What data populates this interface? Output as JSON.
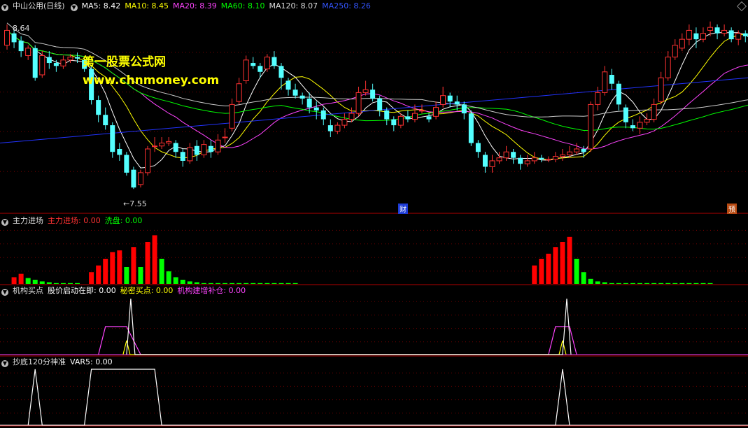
{
  "main": {
    "title": "中山公用(日线)",
    "ma": [
      {
        "label": "MA5: 8.42",
        "color": "#ffffff"
      },
      {
        "label": "MA10: 8.45",
        "color": "#ffff00"
      },
      {
        "label": "MA20: 8.39",
        "color": "#ff44ff"
      },
      {
        "label": "MA60: 8.10",
        "color": "#00ff00"
      },
      {
        "label": "MA120: 8.07",
        "color": "#dddddd"
      },
      {
        "label": "MA250: 8.26",
        "color": "#3333ff"
      }
    ],
    "high_label": "8.64",
    "low_label": "←7.55",
    "cai_tag": "财",
    "yu_tag": "预"
  },
  "watermark": {
    "line1": "第一股票公式网",
    "line2": "www.chnmoney.com"
  },
  "panel1": {
    "name": "主力进场",
    "s1": "主力进场: 0.00",
    "s2": "洗盘: 0.00"
  },
  "panel2": {
    "name": "机构买点",
    "s1": "股价启动在即: 0.00",
    "s2": "秘密买点: 0.00",
    "s3": "机构建增补仓: 0.00"
  },
  "panel3": {
    "name": "抄底120分神准",
    "s1": "VAR5: 0.00"
  },
  "colors": {
    "up": "#ff3232",
    "down": "#54ffff",
    "bar_red": "#ff0000",
    "bar_green": "#00ff00",
    "grid": "#7a0000",
    "divider": "#b00000"
  },
  "chart_data": {
    "type": "candlestick",
    "candles": [
      [
        8.52,
        8.62,
        8.66,
        8.49
      ],
      [
        8.6,
        8.54,
        8.62,
        8.5
      ],
      [
        8.55,
        8.48,
        8.58,
        8.44
      ],
      [
        8.45,
        8.5,
        8.52,
        8.42
      ],
      [
        8.5,
        8.3,
        8.52,
        8.28
      ],
      [
        8.32,
        8.45,
        8.48,
        8.3
      ],
      [
        8.44,
        8.4,
        8.48,
        8.36
      ],
      [
        8.4,
        8.38,
        8.42,
        8.34
      ],
      [
        8.38,
        8.42,
        8.45,
        8.36
      ],
      [
        8.42,
        8.44,
        8.46,
        8.4
      ],
      [
        8.44,
        8.43,
        8.47,
        8.4
      ],
      [
        8.42,
        8.36,
        8.44,
        8.34
      ],
      [
        8.36,
        8.15,
        8.38,
        8.12
      ],
      [
        8.15,
        8.05,
        8.18,
        8.0
      ],
      [
        8.05,
        7.98,
        8.1,
        7.95
      ],
      [
        7.98,
        7.8,
        8.0,
        7.76
      ],
      [
        7.82,
        7.78,
        7.86,
        7.74
      ],
      [
        7.78,
        7.66,
        7.8,
        7.64
      ],
      [
        7.68,
        7.56,
        7.7,
        7.55
      ],
      [
        7.58,
        7.66,
        7.68,
        7.56
      ],
      [
        7.66,
        7.82,
        7.84,
        7.64
      ],
      [
        7.84,
        7.84,
        7.9,
        7.8
      ],
      [
        7.84,
        7.86,
        7.9,
        7.82
      ],
      [
        7.86,
        7.87,
        7.9,
        7.84
      ],
      [
        7.86,
        7.8,
        7.88,
        7.76
      ],
      [
        7.8,
        7.74,
        7.82,
        7.7
      ],
      [
        7.74,
        7.83,
        7.86,
        7.72
      ],
      [
        7.84,
        7.78,
        7.88,
        7.74
      ],
      [
        7.78,
        7.85,
        7.88,
        7.76
      ],
      [
        7.84,
        7.8,
        7.88,
        7.76
      ],
      [
        7.8,
        7.88,
        7.92,
        7.78
      ],
      [
        7.9,
        7.9,
        7.96,
        7.86
      ],
      [
        7.96,
        8.12,
        8.16,
        7.94
      ],
      [
        8.14,
        8.26,
        8.3,
        8.12
      ],
      [
        8.28,
        8.42,
        8.45,
        8.26
      ],
      [
        8.4,
        8.38,
        8.44,
        8.36
      ],
      [
        8.38,
        8.34,
        8.4,
        8.3
      ],
      [
        8.36,
        8.44,
        8.46,
        8.34
      ],
      [
        8.44,
        8.38,
        8.48,
        8.36
      ],
      [
        8.38,
        8.3,
        8.4,
        8.22
      ],
      [
        8.28,
        8.22,
        8.3,
        8.18
      ],
      [
        8.22,
        8.18,
        8.26,
        8.16
      ],
      [
        8.18,
        8.16,
        8.2,
        8.12
      ],
      [
        8.16,
        8.1,
        8.2,
        8.06
      ],
      [
        8.1,
        8.08,
        8.14,
        8.02
      ],
      [
        8.08,
        8.02,
        8.1,
        7.98
      ],
      [
        7.98,
        7.94,
        8.02,
        7.9
      ],
      [
        7.94,
        7.98,
        8.0,
        7.92
      ],
      [
        7.98,
        8.02,
        8.06,
        7.96
      ],
      [
        8.02,
        8.06,
        8.1,
        8.0
      ],
      [
        8.06,
        8.2,
        8.24,
        8.04
      ],
      [
        8.2,
        8.22,
        8.28,
        8.18
      ],
      [
        8.22,
        8.16,
        8.26,
        8.14
      ],
      [
        8.16,
        8.08,
        8.18,
        8.04
      ],
      [
        8.08,
        8.02,
        8.1,
        7.98
      ],
      [
        8.02,
        7.98,
        8.04,
        7.94
      ],
      [
        7.98,
        8.04,
        8.06,
        7.96
      ],
      [
        8.04,
        8.02,
        8.08,
        8.0
      ],
      [
        8.02,
        8.06,
        8.12,
        8.0
      ],
      [
        8.08,
        8.08,
        8.12,
        8.06
      ],
      [
        8.04,
        8.02,
        8.06,
        8.0
      ],
      [
        8.04,
        8.1,
        8.14,
        8.02
      ],
      [
        8.12,
        8.18,
        8.24,
        8.1
      ],
      [
        8.18,
        8.14,
        8.2,
        8.1
      ],
      [
        8.14,
        8.12,
        8.18,
        8.08
      ],
      [
        8.12,
        8.06,
        8.14,
        8.02
      ],
      [
        8.06,
        7.86,
        8.08,
        7.84
      ],
      [
        7.86,
        7.8,
        7.88,
        7.76
      ],
      [
        7.78,
        7.7,
        7.8,
        7.66
      ],
      [
        7.7,
        7.74,
        7.78,
        7.66
      ],
      [
        7.74,
        7.76,
        7.8,
        7.72
      ],
      [
        7.76,
        7.8,
        7.84,
        7.74
      ],
      [
        7.8,
        7.76,
        7.82,
        7.72
      ],
      [
        7.76,
        7.72,
        7.78,
        7.68
      ],
      [
        7.72,
        7.74,
        7.78,
        7.7
      ],
      [
        7.74,
        7.76,
        7.8,
        7.72
      ],
      [
        7.76,
        7.75,
        7.78,
        7.73
      ],
      [
        7.75,
        7.75,
        7.77,
        7.73
      ],
      [
        7.75,
        7.77,
        7.8,
        7.73
      ],
      [
        7.77,
        7.78,
        7.82,
        7.74
      ],
      [
        7.78,
        7.8,
        7.84,
        7.76
      ],
      [
        7.8,
        7.82,
        7.86,
        7.78
      ],
      [
        7.82,
        7.8,
        7.84,
        7.76
      ],
      [
        7.82,
        8.12,
        8.14,
        7.8
      ],
      [
        8.12,
        8.2,
        8.24,
        8.08
      ],
      [
        8.2,
        8.34,
        8.38,
        8.18
      ],
      [
        8.32,
        8.26,
        8.36,
        8.22
      ],
      [
        8.26,
        8.12,
        8.28,
        8.08
      ],
      [
        8.1,
        8.0,
        8.12,
        7.96
      ],
      [
        7.98,
        7.96,
        8.02,
        7.94
      ],
      [
        7.96,
        8.0,
        8.04,
        7.92
      ],
      [
        8.0,
        8.02,
        8.06,
        7.98
      ],
      [
        8.02,
        8.12,
        8.16,
        8.0
      ],
      [
        8.14,
        8.3,
        8.34,
        8.12
      ],
      [
        8.3,
        8.44,
        8.48,
        8.28
      ],
      [
        8.44,
        8.52,
        8.56,
        8.42
      ],
      [
        8.5,
        8.56,
        8.6,
        8.48
      ],
      [
        8.56,
        8.62,
        8.66,
        8.52
      ],
      [
        8.6,
        8.56,
        8.64,
        8.5
      ],
      [
        8.56,
        8.6,
        8.64,
        8.54
      ],
      [
        8.62,
        8.64,
        8.68,
        8.58
      ],
      [
        8.64,
        8.6,
        8.66,
        8.56
      ],
      [
        8.6,
        8.62,
        8.66,
        8.58
      ],
      [
        8.62,
        8.56,
        8.64,
        8.54
      ],
      [
        8.56,
        8.6,
        8.62,
        8.52
      ],
      [
        8.6,
        8.58,
        8.62,
        8.54
      ],
      [
        8.56,
        8.4,
        8.58,
        8.38
      ]
    ],
    "price_range": [
      7.4,
      8.74
    ],
    "panel1_bars": [
      {
        "i": 1,
        "v": 8,
        "c": "red"
      },
      {
        "i": 2,
        "v": 12,
        "c": "red"
      },
      {
        "i": 3,
        "v": 7,
        "c": "green"
      },
      {
        "i": 4,
        "v": 5,
        "c": "green"
      },
      {
        "i": 5,
        "v": 3,
        "c": "green"
      },
      {
        "i": 6,
        "v": 2,
        "c": "green"
      },
      {
        "i": 7,
        "v": 1,
        "c": "green"
      },
      {
        "i": 8,
        "v": 1,
        "c": "green"
      },
      {
        "i": 9,
        "v": 1,
        "c": "green"
      },
      {
        "i": 10,
        "v": 1,
        "c": "green"
      },
      {
        "i": 12,
        "v": 14,
        "c": "red"
      },
      {
        "i": 13,
        "v": 22,
        "c": "red"
      },
      {
        "i": 14,
        "v": 30,
        "c": "red"
      },
      {
        "i": 15,
        "v": 38,
        "c": "red"
      },
      {
        "i": 16,
        "v": 40,
        "c": "red"
      },
      {
        "i": 17,
        "v": 20,
        "c": "green"
      },
      {
        "i": 18,
        "v": 44,
        "c": "red"
      },
      {
        "i": 19,
        "v": 20,
        "c": "green"
      },
      {
        "i": 20,
        "v": 50,
        "c": "red"
      },
      {
        "i": 21,
        "v": 58,
        "c": "red"
      },
      {
        "i": 22,
        "v": 30,
        "c": "green"
      },
      {
        "i": 23,
        "v": 15,
        "c": "green"
      },
      {
        "i": 24,
        "v": 8,
        "c": "green"
      },
      {
        "i": 25,
        "v": 5,
        "c": "green"
      },
      {
        "i": 26,
        "v": 3,
        "c": "green"
      },
      {
        "i": 27,
        "v": 2,
        "c": "green"
      },
      {
        "i": 28,
        "v": 1,
        "c": "green"
      },
      {
        "i": 29,
        "v": 1,
        "c": "green"
      },
      {
        "i": 30,
        "v": 1,
        "c": "green"
      },
      {
        "i": 31,
        "v": 1,
        "c": "green"
      },
      {
        "i": 32,
        "v": 1,
        "c": "green"
      },
      {
        "i": 33,
        "v": 1,
        "c": "green"
      },
      {
        "i": 34,
        "v": 1,
        "c": "green"
      },
      {
        "i": 35,
        "v": 1,
        "c": "green"
      },
      {
        "i": 36,
        "v": 1,
        "c": "green"
      },
      {
        "i": 37,
        "v": 1,
        "c": "green"
      },
      {
        "i": 38,
        "v": 1,
        "c": "green"
      },
      {
        "i": 39,
        "v": 1,
        "c": "green"
      },
      {
        "i": 40,
        "v": 1,
        "c": "green"
      },
      {
        "i": 41,
        "v": 1,
        "c": "green"
      },
      {
        "i": 75,
        "v": 22,
        "c": "red"
      },
      {
        "i": 76,
        "v": 30,
        "c": "red"
      },
      {
        "i": 77,
        "v": 36,
        "c": "red"
      },
      {
        "i": 78,
        "v": 44,
        "c": "red"
      },
      {
        "i": 79,
        "v": 50,
        "c": "red"
      },
      {
        "i": 80,
        "v": 56,
        "c": "red"
      },
      {
        "i": 81,
        "v": 30,
        "c": "green"
      },
      {
        "i": 82,
        "v": 14,
        "c": "green"
      },
      {
        "i": 83,
        "v": 6,
        "c": "green"
      },
      {
        "i": 84,
        "v": 3,
        "c": "green"
      },
      {
        "i": 85,
        "v": 2,
        "c": "green"
      },
      {
        "i": 86,
        "v": 1,
        "c": "green"
      },
      {
        "i": 87,
        "v": 1,
        "c": "green"
      },
      {
        "i": 88,
        "v": 1,
        "c": "green"
      },
      {
        "i": 89,
        "v": 1,
        "c": "green"
      },
      {
        "i": 90,
        "v": 1,
        "c": "green"
      },
      {
        "i": 91,
        "v": 1,
        "c": "green"
      },
      {
        "i": 92,
        "v": 1,
        "c": "green"
      },
      {
        "i": 93,
        "v": 1,
        "c": "green"
      },
      {
        "i": 94,
        "v": 1,
        "c": "green"
      },
      {
        "i": 95,
        "v": 1,
        "c": "green"
      },
      {
        "i": 96,
        "v": 1,
        "c": "green"
      },
      {
        "i": 97,
        "v": 1,
        "c": "green"
      },
      {
        "i": 98,
        "v": 1,
        "c": "green"
      },
      {
        "i": 99,
        "v": 1,
        "c": "green"
      },
      {
        "i": 100,
        "v": 1,
        "c": "green"
      }
    ],
    "panel2_white": [
      [
        17,
        0
      ],
      [
        17.6,
        1
      ],
      [
        18.2,
        0
      ],
      [
        79,
        0
      ],
      [
        79.6,
        1
      ],
      [
        80.2,
        0
      ]
    ],
    "panel2_magenta": [
      [
        13,
        0
      ],
      [
        14,
        0.5
      ],
      [
        17,
        0.5
      ],
      [
        19,
        0
      ],
      [
        77,
        0
      ],
      [
        78,
        0.5
      ],
      [
        80,
        0.5
      ],
      [
        81,
        0
      ]
    ],
    "panel2_yellow": [
      [
        16.5,
        0
      ],
      [
        17,
        0.25
      ],
      [
        17.5,
        0
      ],
      [
        78.5,
        0
      ],
      [
        79,
        0.25
      ],
      [
        79.5,
        0
      ]
    ],
    "panel3_white": [
      [
        3,
        0
      ],
      [
        4,
        1
      ],
      [
        5,
        0
      ],
      [
        11,
        0
      ],
      [
        12,
        1
      ],
      [
        21,
        1
      ],
      [
        22,
        0
      ],
      [
        78,
        0
      ],
      [
        79,
        1
      ],
      [
        80,
        0
      ]
    ]
  }
}
